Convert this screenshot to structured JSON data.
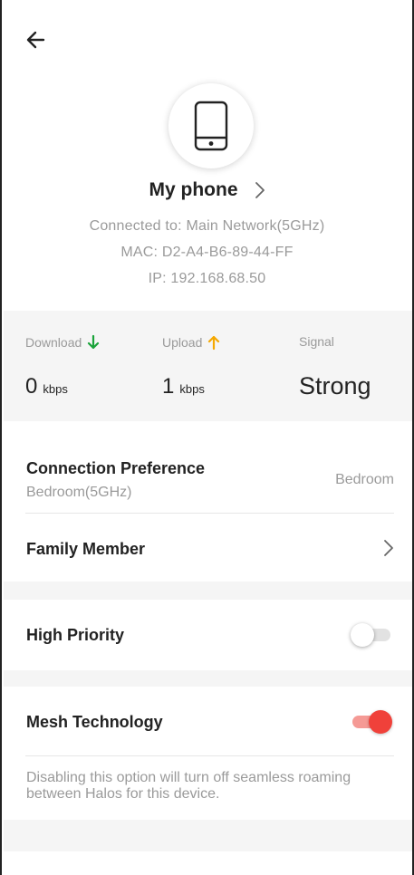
{
  "header": {
    "back_icon": "arrow-left-icon"
  },
  "device": {
    "icon": "smartphone-icon",
    "name": "My phone",
    "connected_to": "Connected to: Main Network(5GHz)",
    "mac": "MAC: D2-A4-B6-89-44-FF",
    "ip": "IP: 192.168.68.50"
  },
  "stats": {
    "download_label": "Download",
    "download_value": "0",
    "download_unit": "kbps",
    "upload_label": "Upload",
    "upload_value": "1",
    "upload_unit": "kbps",
    "signal_label": "Signal",
    "signal_value": "Strong"
  },
  "settings": {
    "connection_preference": {
      "title": "Connection Preference",
      "subtitle": "Bedroom(5GHz)",
      "value": "Bedroom"
    },
    "family_member": {
      "title": "Family Member"
    },
    "high_priority": {
      "title": "High Priority",
      "enabled": false
    },
    "mesh_technology": {
      "title": "Mesh Technology",
      "enabled": true,
      "note": "Disabling this option will turn off seamless roaming between Halos for this device."
    }
  },
  "colors": {
    "download_arrow": "#1aa33a",
    "upload_arrow": "#f5a800",
    "toggle_on": "#f0413a",
    "toggle_on_track": "#f59a95",
    "section_bg": "#f5f5f5"
  }
}
